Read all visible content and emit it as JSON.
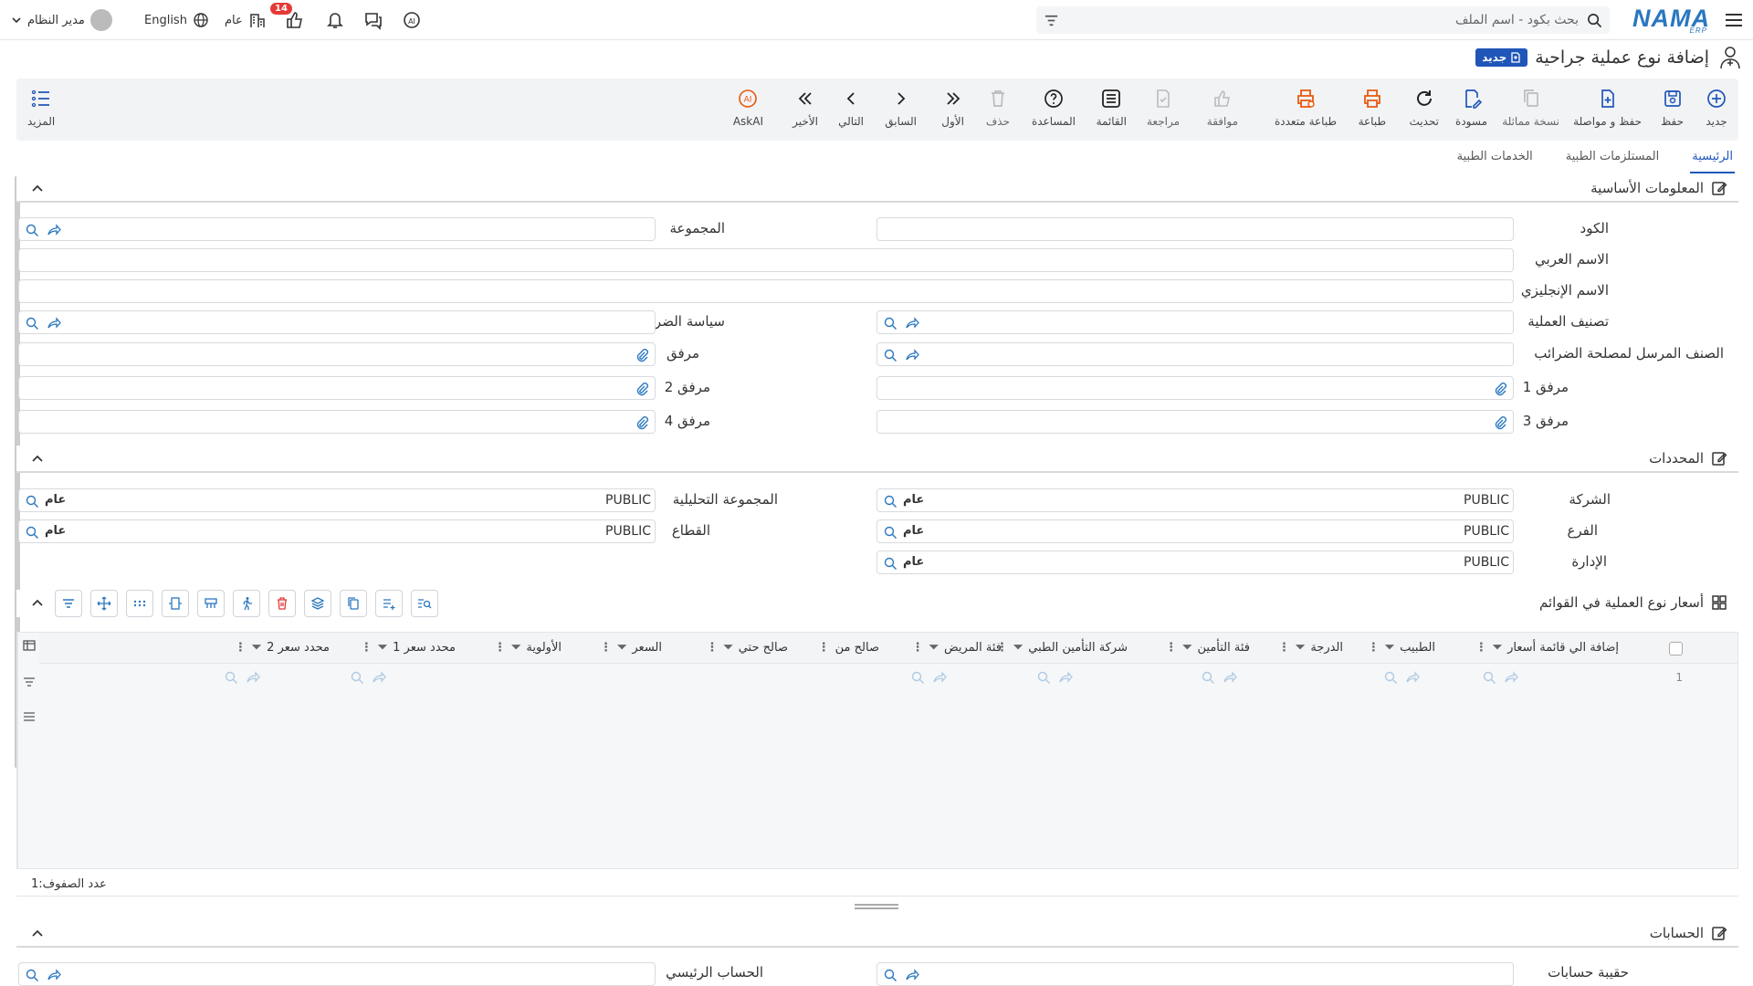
{
  "topbar": {
    "brand": "NAMA",
    "brand_sub": "ERP",
    "search_placeholder": "بحث بكود - اسم الملف",
    "user_name": "مدير النظام",
    "language": "English",
    "public_label": "عام",
    "notification_count": "14"
  },
  "page": {
    "title": "إضافة نوع عملية جراحية",
    "new_badge": "جديد"
  },
  "toolbar": {
    "new": "جديد",
    "save": "حفظ",
    "save_continue": "حفظ و مواصلة",
    "duplicate": "نسخة مماثلة",
    "draft": "مسودة",
    "refresh": "تحديث",
    "print": "طباعة",
    "multi_print": "طباعة متعددة",
    "approve": "موافقة",
    "review": "مراجعة",
    "list": "القائمة",
    "help": "المساعدة",
    "delete": "حذف",
    "first": "الأول",
    "previous": "السابق",
    "next": "التالي",
    "last": "الأخير",
    "askai": "AskAI",
    "more": "المزيد"
  },
  "tabs": [
    "الرئيسية",
    "المستلزمات الطبية",
    "الخدمات الطبية"
  ],
  "basic": {
    "title": "المعلومات الأساسية",
    "code": "الكود",
    "group": "المجموعة",
    "arabic_name": "الاسم العربي",
    "english_name": "الاسم الإنجليزي",
    "op_class": "تصنيف العملية",
    "tax_policy": "سياسة الضريبة",
    "tax_item": "الصنف المرسل لمصلحة الضرائب",
    "attachment": "مرفق",
    "attachment1": "مرفق 1",
    "attachment2": "مرفق 2",
    "attachment3": "مرفق 3",
    "attachment4": "مرفق 4"
  },
  "determinants": {
    "title": "المحددات",
    "company": "الشركة",
    "analytic_group": "المجموعة التحليلية",
    "branch": "الفرع",
    "sector": "القطاع",
    "department": "الإدارة",
    "value": "PUBLIC",
    "tag": "عام"
  },
  "prices": {
    "title": "أسعار نوع العملية في القوائم",
    "columns": [
      "إضافة الي قائمة أسعار",
      "الطبيب",
      "الدرجة",
      "فئة التأمين",
      "شركة التأمين الطبي",
      "فئة المريض",
      "صالح من",
      "صالح حتي",
      "السعر",
      "الأولوية",
      "محدد سعر 1",
      "محدد سعر 2"
    ],
    "row_number": "1",
    "row_count_label": "عدد الصفوف:",
    "row_count": "1"
  },
  "accounts": {
    "title": "الحسابات",
    "account_bag": "حقيبة حسابات",
    "main_account": "الحساب الرئيسي"
  },
  "colors": {
    "accent": "#1f56b8",
    "brand": "#2a77bf",
    "orange": "#e8590c"
  }
}
